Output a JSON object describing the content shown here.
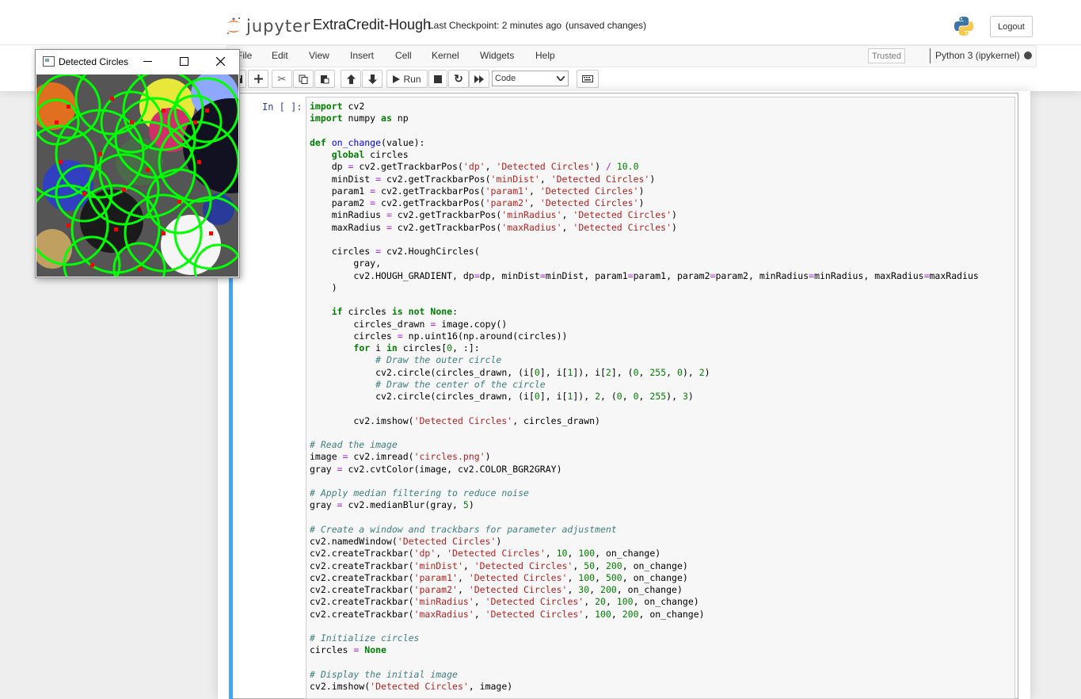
{
  "header": {
    "logo_text": "jupyter",
    "notebook_name": "ExtraCredit-Hough",
    "checkpoint": "Last Checkpoint: 2 minutes ago",
    "unsaved": "(unsaved changes)",
    "logout_label": "Logout"
  },
  "menubar": {
    "items": [
      "File",
      "Edit",
      "View",
      "Insert",
      "Cell",
      "Kernel",
      "Widgets",
      "Help"
    ],
    "trusted": "Trusted",
    "kernel": "Python 3 (ipykernel)"
  },
  "toolbar": {
    "run_label": "Run",
    "cell_type": "Code"
  },
  "cell": {
    "prompt": "In [ ]:",
    "code_lines": [
      "import cv2",
      "import numpy as np",
      "",
      "def on_change(value):",
      "    global circles",
      "    dp = cv2.getTrackbarPos('dp', 'Detected Circles') / 10.0",
      "    minDist = cv2.getTrackbarPos('minDist', 'Detected Circles')",
      "    param1 = cv2.getTrackbarPos('param1', 'Detected Circles')",
      "    param2 = cv2.getTrackbarPos('param2', 'Detected Circles')",
      "    minRadius = cv2.getTrackbarPos('minRadius', 'Detected Circles')",
      "    maxRadius = cv2.getTrackbarPos('maxRadius', 'Detected Circles')",
      "",
      "    circles = cv2.HoughCircles(",
      "        gray,",
      "        cv2.HOUGH_GRADIENT, dp=dp, minDist=minDist, param1=param1, param2=param2, minRadius=minRadius, maxRadius=maxRadius",
      "    )",
      "",
      "    if circles is not None:",
      "        circles_drawn = image.copy()",
      "        circles = np.uint16(np.around(circles))",
      "        for i in circles[0, :]:",
      "            # Draw the outer circle",
      "            cv2.circle(circles_drawn, (i[0], i[1]), i[2], (0, 255, 0), 2)",
      "            # Draw the center of the circle",
      "            cv2.circle(circles_drawn, (i[0], i[1]), 2, (0, 0, 255), 3)",
      "",
      "        cv2.imshow('Detected Circles', circles_drawn)",
      "",
      "# Read the image",
      "image = cv2.imread('circles.png')",
      "gray = cv2.cvtColor(image, cv2.COLOR_BGR2GRAY)",
      "",
      "# Apply median filtering to reduce noise",
      "gray = cv2.medianBlur(gray, 5)",
      "",
      "# Create a window and trackbars for parameter adjustment",
      "cv2.namedWindow('Detected Circles')",
      "cv2.createTrackbar('dp', 'Detected Circles', 10, 100, on_change)",
      "cv2.createTrackbar('minDist', 'Detected Circles', 50, 200, on_change)",
      "cv2.createTrackbar('param1', 'Detected Circles', 100, 500, on_change)",
      "cv2.createTrackbar('param2', 'Detected Circles', 30, 200, on_change)",
      "cv2.createTrackbar('minRadius', 'Detected Circles', 20, 100, on_change)",
      "cv2.createTrackbar('maxRadius', 'Detected Circles', 100, 200, on_change)",
      "",
      "# Initialize circles",
      "circles = None",
      "",
      "# Display the initial image",
      "cv2.imshow('Detected Circles', image)"
    ]
  },
  "popup": {
    "title": "Detected Circles"
  },
  "colors": {
    "accent_blue": "#42a5f5",
    "jupyter_orange": "#f37726",
    "circle_green": "#00ff00",
    "center_red": "#ff0000"
  }
}
